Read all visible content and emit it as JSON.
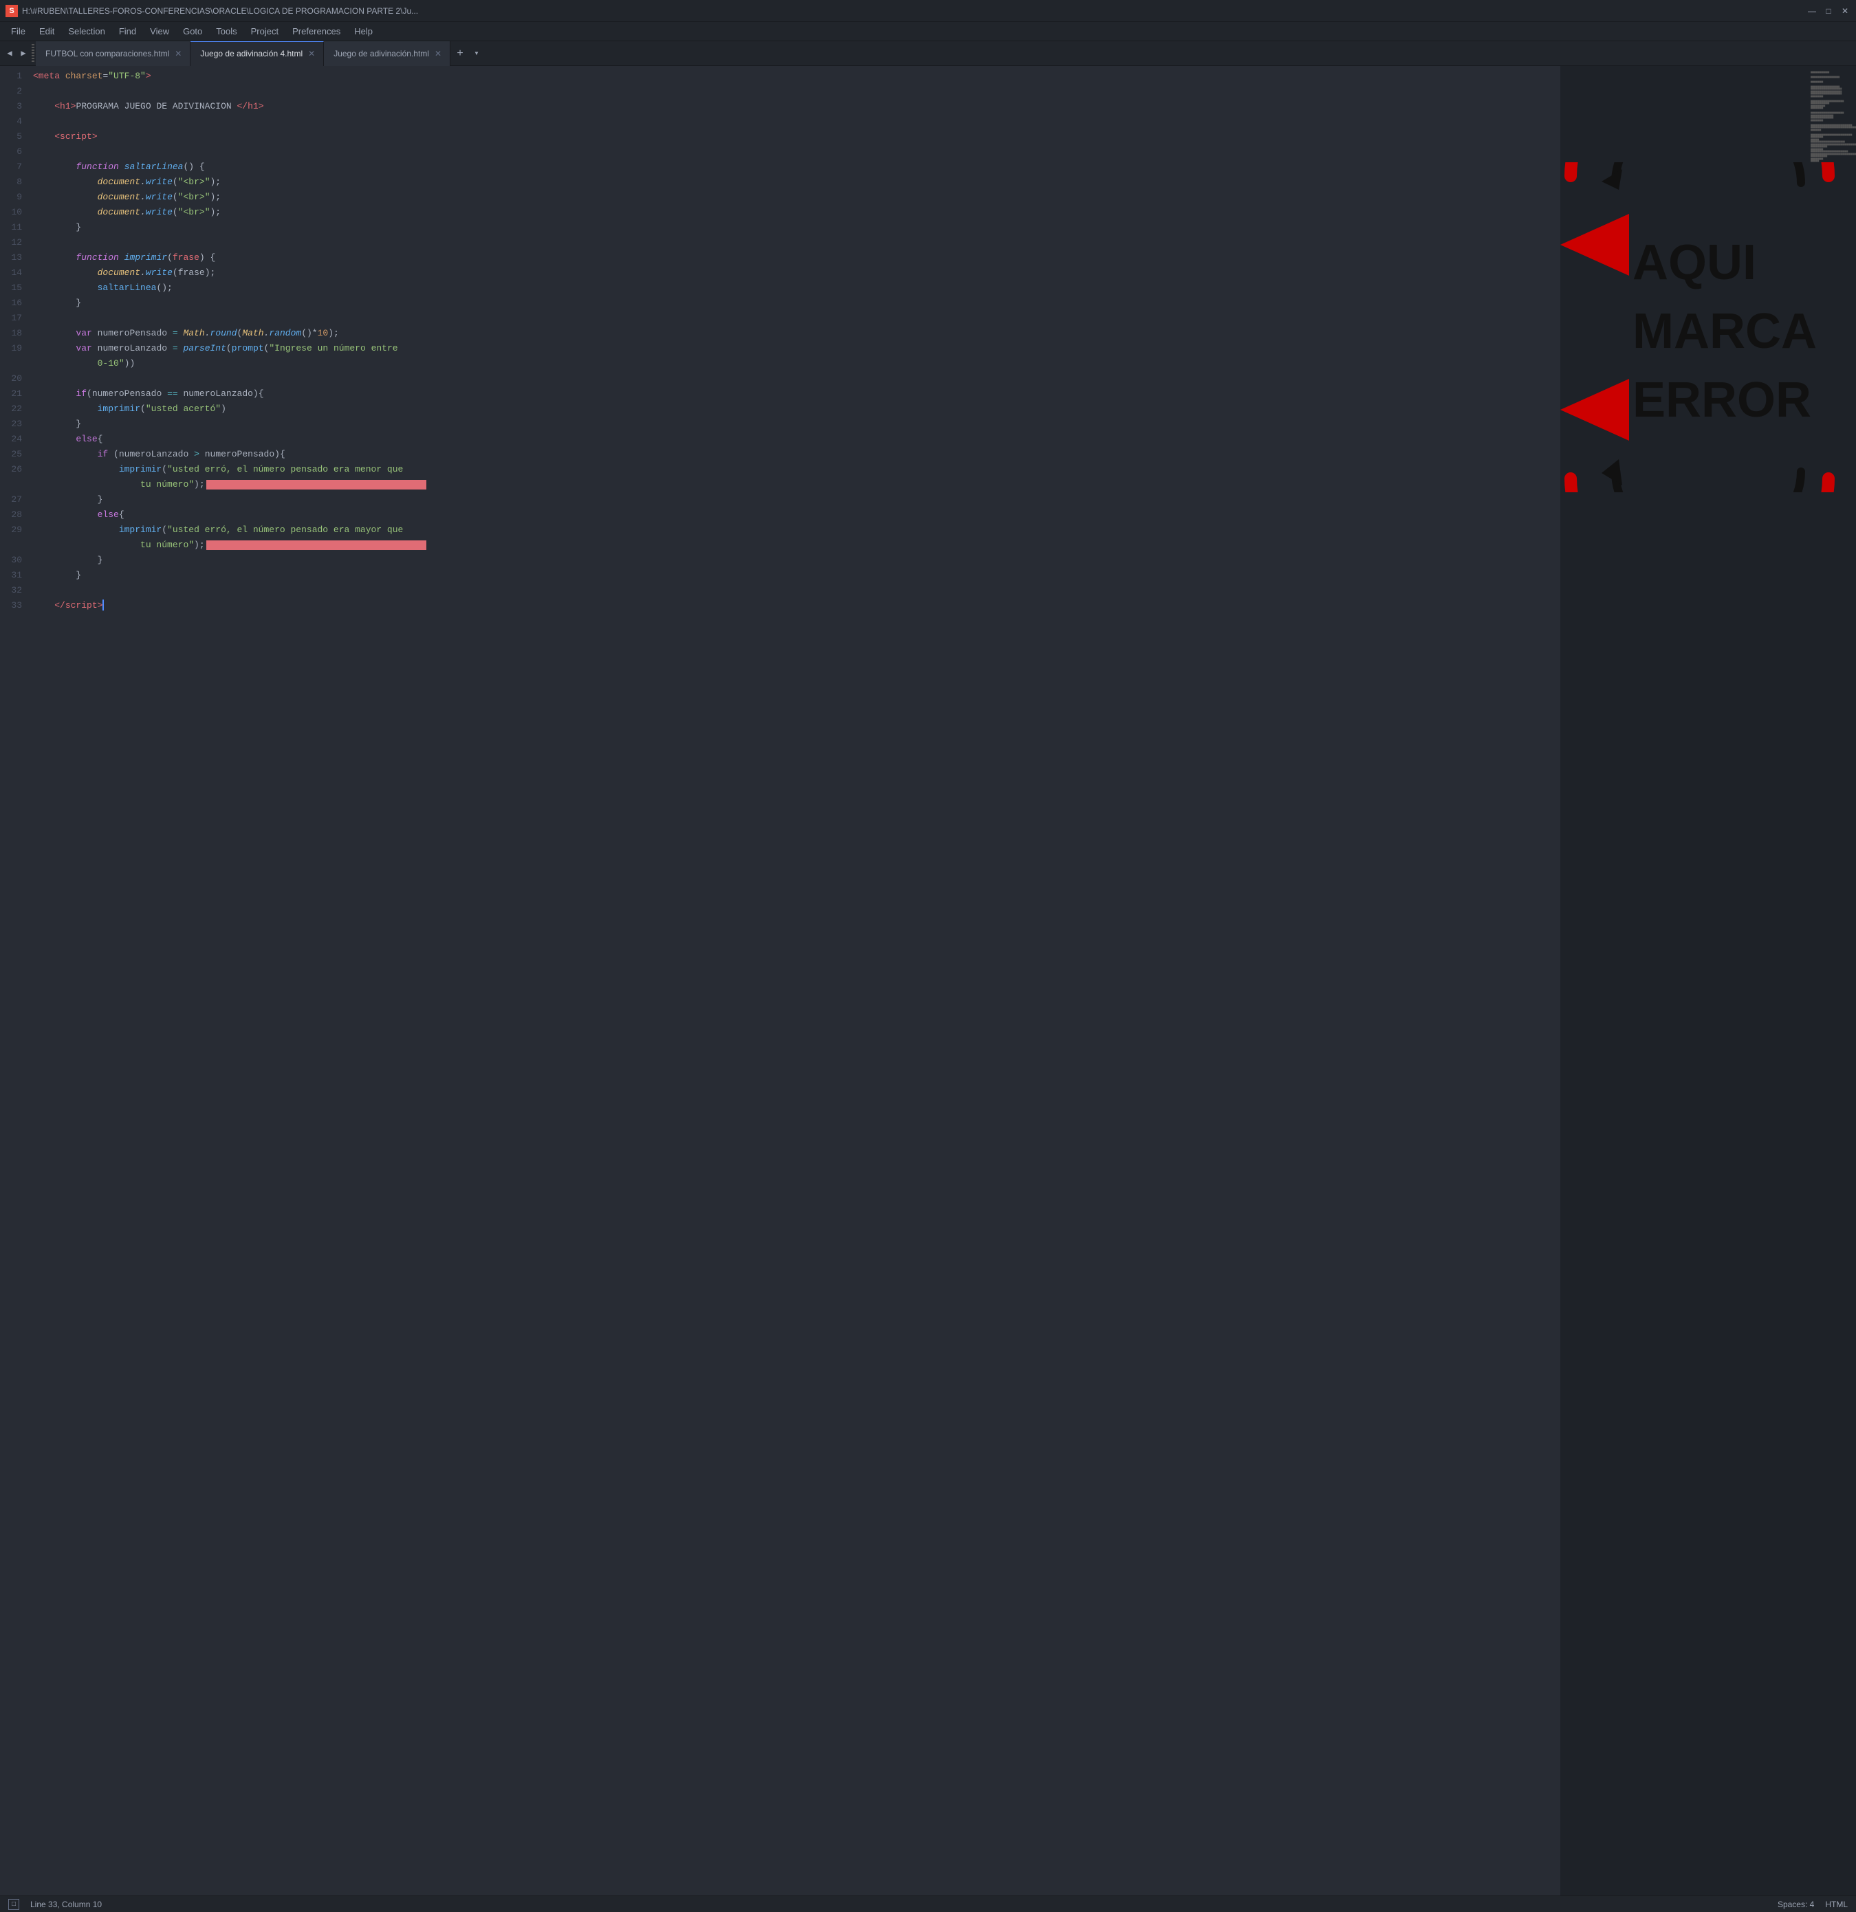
{
  "titleBar": {
    "icon": "S",
    "title": "H:\\#RUBEN\\TALLERES-FOROS-CONFERENCIAS\\ORACLE\\LOGICA DE PROGRAMACION PARTE 2\\Ju...",
    "minimize": "—",
    "maximize": "□",
    "close": "✕"
  },
  "menuBar": {
    "items": [
      "File",
      "Edit",
      "Selection",
      "Find",
      "View",
      "Goto",
      "Tools",
      "Project",
      "Preferences",
      "Help"
    ]
  },
  "tabs": [
    {
      "label": "FUTBOL con comparaciones.html",
      "active": false
    },
    {
      "label": "Juego de adivinación 4.html",
      "active": true
    },
    {
      "label": "Juego de adivinación.html",
      "active": false
    }
  ],
  "statusBar": {
    "position": "Line 33, Column 10",
    "spaces": "Spaces: 4",
    "language": "HTML"
  },
  "annotation": {
    "line1": "AQUI",
    "line2": "MARCA",
    "line3": "ERROR"
  }
}
